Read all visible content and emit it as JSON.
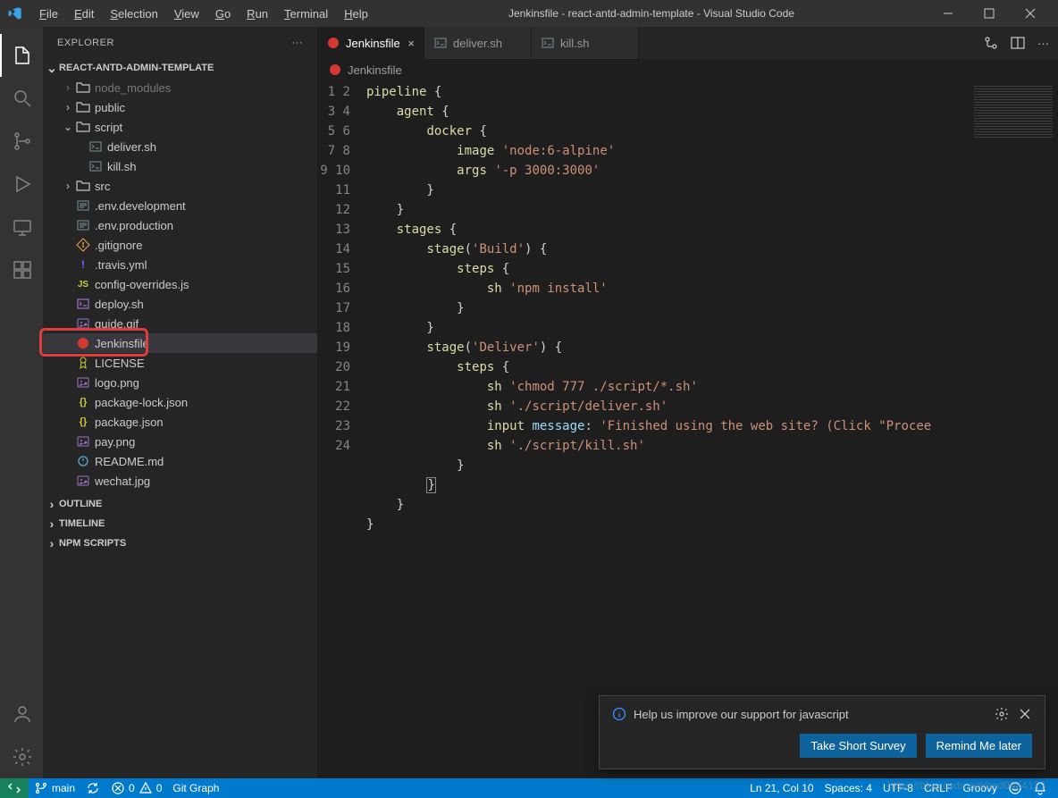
{
  "window": {
    "title": "Jenkinsfile - react-antd-admin-template - Visual Studio Code"
  },
  "menus": [
    {
      "label": "File",
      "u": "F"
    },
    {
      "label": "Edit",
      "u": "E"
    },
    {
      "label": "Selection",
      "u": "S"
    },
    {
      "label": "View",
      "u": "V"
    },
    {
      "label": "Go",
      "u": "G"
    },
    {
      "label": "Run",
      "u": "R"
    },
    {
      "label": "Terminal",
      "u": "T"
    },
    {
      "label": "Help",
      "u": "H"
    }
  ],
  "explorer": {
    "title": "EXPLORER",
    "project": "REACT-ANTD-ADMIN-TEMPLATE",
    "tree": [
      {
        "type": "folder",
        "name": "node_modules",
        "depth": 1,
        "open": false,
        "dim": true
      },
      {
        "type": "folder",
        "name": "public",
        "depth": 1,
        "open": false
      },
      {
        "type": "folder",
        "name": "script",
        "depth": 1,
        "open": true
      },
      {
        "type": "file",
        "name": "deliver.sh",
        "depth": 2,
        "icon": "sh"
      },
      {
        "type": "file",
        "name": "kill.sh",
        "depth": 2,
        "icon": "sh"
      },
      {
        "type": "folder",
        "name": "src",
        "depth": 1,
        "open": false
      },
      {
        "type": "file",
        "name": ".env.development",
        "depth": 1,
        "icon": "env"
      },
      {
        "type": "file",
        "name": ".env.production",
        "depth": 1,
        "icon": "env"
      },
      {
        "type": "file",
        "name": ".gitignore",
        "depth": 1,
        "icon": "git"
      },
      {
        "type": "file",
        "name": ".travis.yml",
        "depth": 1,
        "icon": "yml"
      },
      {
        "type": "file",
        "name": "config-overrides.js",
        "depth": 1,
        "icon": "js"
      },
      {
        "type": "file",
        "name": "deploy.sh",
        "depth": 1,
        "icon": "sh2"
      },
      {
        "type": "file",
        "name": "guide.gif",
        "depth": 1,
        "icon": "img"
      },
      {
        "type": "file",
        "name": "Jenkinsfile",
        "depth": 1,
        "icon": "jenkins",
        "selected": true,
        "highlight": true
      },
      {
        "type": "file",
        "name": "LICENSE",
        "depth": 1,
        "icon": "lic"
      },
      {
        "type": "file",
        "name": "logo.png",
        "depth": 1,
        "icon": "img"
      },
      {
        "type": "file",
        "name": "package-lock.json",
        "depth": 1,
        "icon": "json"
      },
      {
        "type": "file",
        "name": "package.json",
        "depth": 1,
        "icon": "json"
      },
      {
        "type": "file",
        "name": "pay.png",
        "depth": 1,
        "icon": "img"
      },
      {
        "type": "file",
        "name": "README.md",
        "depth": 1,
        "icon": "md"
      },
      {
        "type": "file",
        "name": "wechat.jpg",
        "depth": 1,
        "icon": "img"
      }
    ],
    "outline": "OUTLINE",
    "timeline": "TIMELINE",
    "npm": "NPM SCRIPTS"
  },
  "tabs": [
    {
      "label": "Jenkinsfile",
      "icon": "jenkins",
      "active": true,
      "close": true
    },
    {
      "label": "deliver.sh",
      "icon": "sh",
      "active": false
    },
    {
      "label": "kill.sh",
      "icon": "sh",
      "active": false
    }
  ],
  "breadcrumb": {
    "file": "Jenkinsfile",
    "icon": "jenkins"
  },
  "code": {
    "lines": 24,
    "content": [
      [
        [
          "fn",
          "pipeline"
        ],
        [
          "pn",
          " {"
        ]
      ],
      [
        [
          "pn",
          "    "
        ],
        [
          "fn",
          "agent"
        ],
        [
          "pn",
          " {"
        ]
      ],
      [
        [
          "pn",
          "        "
        ],
        [
          "fn",
          "docker"
        ],
        [
          "pn",
          " {"
        ]
      ],
      [
        [
          "pn",
          "            "
        ],
        [
          "fn",
          "image"
        ],
        [
          "pn",
          " "
        ],
        [
          "str",
          "'node:6-alpine'"
        ]
      ],
      [
        [
          "pn",
          "            "
        ],
        [
          "fn",
          "args"
        ],
        [
          "pn",
          " "
        ],
        [
          "str",
          "'-p 3000:3000'"
        ]
      ],
      [
        [
          "pn",
          "        }"
        ]
      ],
      [
        [
          "pn",
          "    }"
        ]
      ],
      [
        [
          "pn",
          "    "
        ],
        [
          "fn",
          "stages"
        ],
        [
          "pn",
          " {"
        ]
      ],
      [
        [
          "pn",
          "        "
        ],
        [
          "fn",
          "stage"
        ],
        [
          "pn",
          "("
        ],
        [
          "str",
          "'Build'"
        ],
        [
          "pn",
          ") {"
        ]
      ],
      [
        [
          "pn",
          "            "
        ],
        [
          "fn",
          "steps"
        ],
        [
          "pn",
          " {"
        ]
      ],
      [
        [
          "pn",
          "                "
        ],
        [
          "fn",
          "sh"
        ],
        [
          "pn",
          " "
        ],
        [
          "str",
          "'npm install'"
        ]
      ],
      [
        [
          "pn",
          "            }"
        ]
      ],
      [
        [
          "pn",
          "        }"
        ]
      ],
      [
        [
          "pn",
          "        "
        ],
        [
          "fn",
          "stage"
        ],
        [
          "pn",
          "("
        ],
        [
          "str",
          "'Deliver'"
        ],
        [
          "pn",
          ") {"
        ]
      ],
      [
        [
          "pn",
          "            "
        ],
        [
          "fn",
          "steps"
        ],
        [
          "pn",
          " {"
        ]
      ],
      [
        [
          "pn",
          "                "
        ],
        [
          "fn",
          "sh"
        ],
        [
          "pn",
          " "
        ],
        [
          "str",
          "'chmod 777 ./script/*.sh'"
        ]
      ],
      [
        [
          "pn",
          "                "
        ],
        [
          "fn",
          "sh"
        ],
        [
          "pn",
          " "
        ],
        [
          "str",
          "'./script/deliver.sh'"
        ]
      ],
      [
        [
          "pn",
          "                "
        ],
        [
          "fn",
          "input"
        ],
        [
          "pn",
          " "
        ],
        [
          "prop",
          "message"
        ],
        [
          "pn",
          ": "
        ],
        [
          "str",
          "'Finished using the web site? (Click \"Procee"
        ]
      ],
      [
        [
          "pn",
          "                "
        ],
        [
          "fn",
          "sh"
        ],
        [
          "pn",
          " "
        ],
        [
          "str",
          "'./script/kill.sh'"
        ]
      ],
      [
        [
          "pn",
          "            }"
        ]
      ],
      [
        [
          "pn",
          "        "
        ],
        [
          "cursor",
          "}"
        ]
      ],
      [
        [
          "pn",
          "    }"
        ]
      ],
      [
        [
          "pn",
          "}"
        ]
      ],
      [
        [
          "pn",
          ""
        ]
      ]
    ]
  },
  "statusbar": {
    "branch": "main",
    "errors": "0",
    "warnings": "0",
    "gitgraph": "Git Graph",
    "ln_col": "Ln 21, Col 10",
    "spaces": "Spaces: 4",
    "encoding": "UTF-8",
    "eol": "CRLF",
    "lang": "Groovy"
  },
  "notification": {
    "message": "Help us improve our support for javascript",
    "primary": "Take Short Survey",
    "secondary": "Remind Me later"
  },
  "icons": {
    "colors": {
      "jenkins": "#d33833",
      "js": "#cbcb41",
      "json": "#cbcb41",
      "yml": "#7b61ff",
      "img": "#a074c4",
      "md": "#519aba",
      "sh": "#6d8086",
      "sh2": "#a074c4",
      "env": "#6d8086",
      "git": "#e8a24f",
      "lic": "#cbcb41"
    }
  },
  "watermark": "https://blog.csdn.net/asd0654123"
}
